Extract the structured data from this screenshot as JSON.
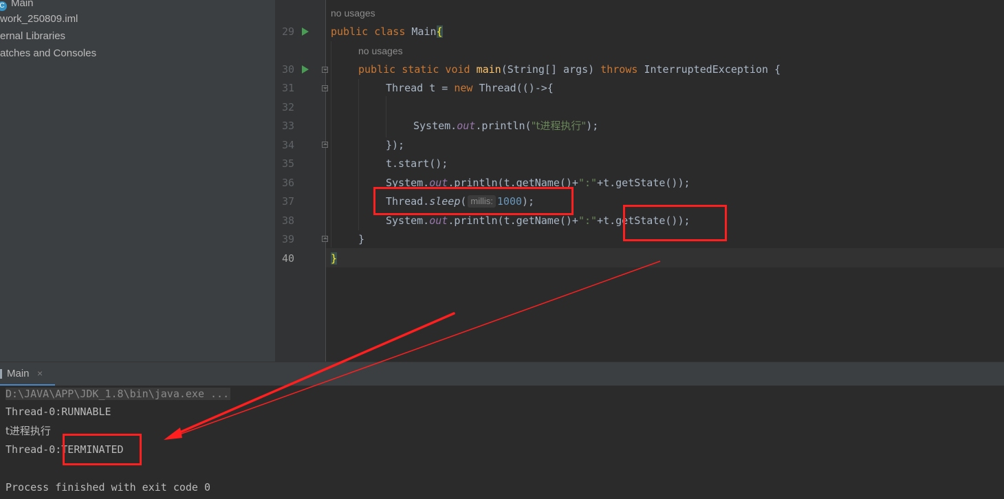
{
  "project_tree": {
    "items": [
      {
        "label": "Main",
        "icon": "java-class-icon"
      },
      {
        "label": "work_250809.iml"
      },
      {
        "label": "ernal Libraries"
      },
      {
        "label": "atches and Consoles"
      }
    ]
  },
  "editor": {
    "line_numbers": [
      "29",
      "30",
      "31",
      "32",
      "33",
      "34",
      "35",
      "36",
      "37",
      "38",
      "39",
      "40"
    ],
    "hints": {
      "class_usages": "no usages",
      "method_usages": "no usages"
    },
    "code": {
      "l29": {
        "kw": "public class ",
        "name": "Main",
        "brace": "{"
      },
      "l30": {
        "kw": "public static void ",
        "fn": "main",
        "args": "(String[] args) ",
        "throws_kw": "throws ",
        "rest": "InterruptedException {"
      },
      "l31": {
        "a": "Thread t = ",
        "kw": "new ",
        "b": "Thread(()->{"
      },
      "l33": {
        "a": "System.",
        "st": "out",
        "b": ".println(",
        "str": "\"t进程执行\"",
        "c": ");"
      },
      "l34": {
        "a": "});"
      },
      "l35": {
        "a": "t.start();"
      },
      "l36": {
        "a": "System.",
        "st": "out",
        "b": ".println(t.getName()+",
        "str": "\":\"",
        "c": "+t.getState());"
      },
      "l37": {
        "a": "Thread.",
        "it": "sleep",
        "b": "(",
        "param": "millis:",
        "num": "1000",
        "c": ");"
      },
      "l38": {
        "a": "System.",
        "st": "out",
        "b": ".println(t.getName()+",
        "str": "\":\"",
        "c": "+t.getState());"
      },
      "l39": {
        "a": "}"
      },
      "l40": {
        "a": "}"
      }
    }
  },
  "run": {
    "tab_label": "Main",
    "tab_close": "×",
    "console": {
      "command": "D:\\JAVA\\APP\\JDK_1.8\\bin\\java.exe ...",
      "line1": "Thread-0:RUNNABLE",
      "line2": "t进程执行",
      "line3_prefix": "Thread-0:",
      "line3_state": "TERMINATED",
      "exit": "Process finished with exit code 0"
    }
  },
  "colors": {
    "keyword": "#cc7832",
    "method": "#ffc66d",
    "static_field": "#9876aa",
    "string": "#6a8759",
    "number": "#6897bb",
    "annotation_red": "#ff1f1f",
    "run_icon": "#499c54"
  }
}
